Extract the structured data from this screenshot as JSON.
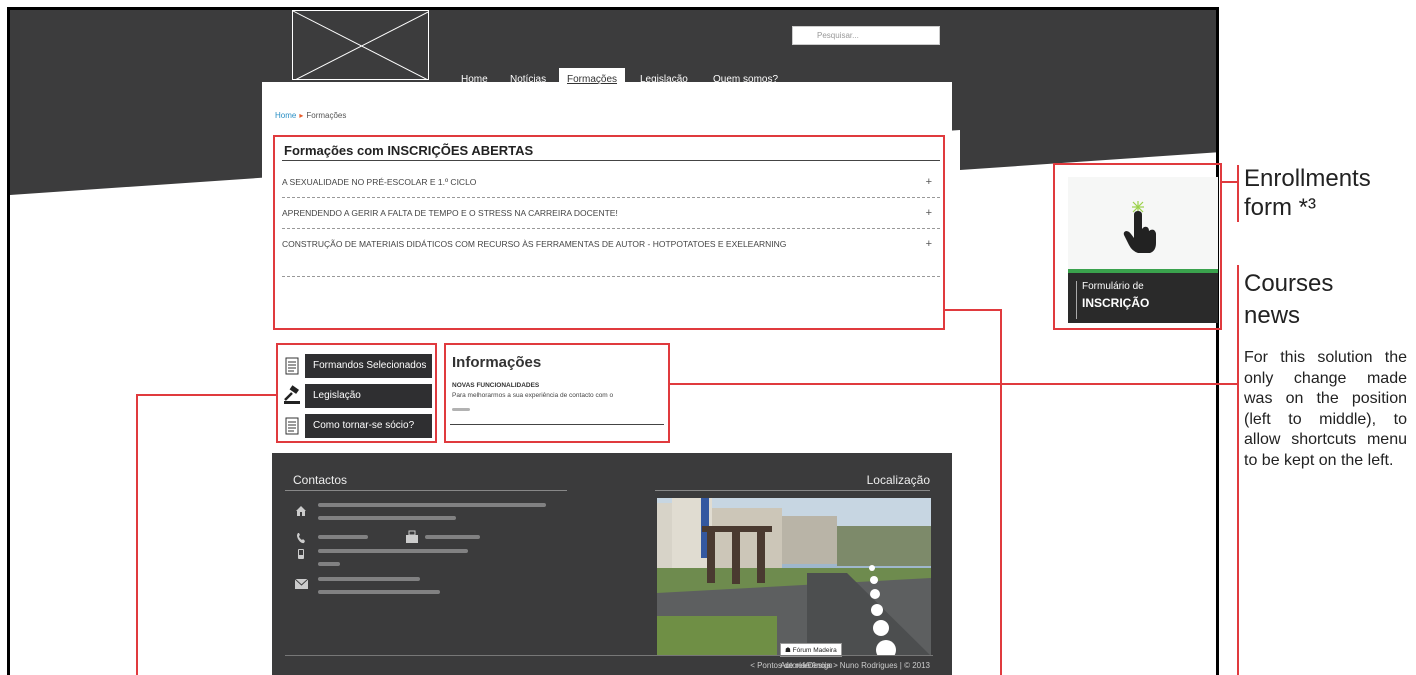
{
  "header": {
    "search_placeholder": "Pesquisar...",
    "nav": [
      "Home",
      "Notícias",
      "Formações",
      "Legislação",
      "Quem somos?"
    ]
  },
  "breadcrumb": {
    "home": "Home",
    "current": "Formações"
  },
  "courses": {
    "title": "Formações com INSCRIÇÕES ABERTAS",
    "items": [
      "A SEXUALIDADE NO PRÉ-ESCOLAR E 1.º CICLO",
      "APRENDENDO A GERIR A FALTA DE TEMPO E O STRESS NA CARREIRA DOCENTE!",
      "CONSTRUÇÃO DE MATERIAIS DIDÁTICOS COM RECURSO ÀS FERRAMENTAS DE AUTOR - HOTPOTATOES E EXELEARNING"
    ],
    "expand_symbol": "+"
  },
  "shortcuts": [
    "Formandos Selecionados",
    "Legislação",
    "Como tornar-se sócio?"
  ],
  "info": {
    "title": "Informações",
    "subtitle": "NOVAS FUNCIONALIDADES",
    "text": "Para melhorarmos a sua experiência de contacto com o"
  },
  "footer": {
    "contacts_title": "Contactos",
    "location_title": "Localização",
    "map_label": "Fórum Madeira",
    "map_nav": "<   Pontos de referência   >",
    "credits": "Autoria/Design - Nuno Rodrigues  |  © 2013"
  },
  "enroll_card": {
    "line1": "Formulário de",
    "line2": "INSCRIÇÃO"
  },
  "annotations": {
    "enrollments": [
      "Enrollments",
      "form *³"
    ],
    "courses_news": [
      "Courses",
      "news"
    ],
    "note": "For this solution the only change made was on the position (left to middle), to allow shortcuts menu to be kept on the left."
  },
  "colors": {
    "dark": "#3b3b3c",
    "accent_red": "#e03a3e",
    "link_blue": "#2a8fc5"
  }
}
